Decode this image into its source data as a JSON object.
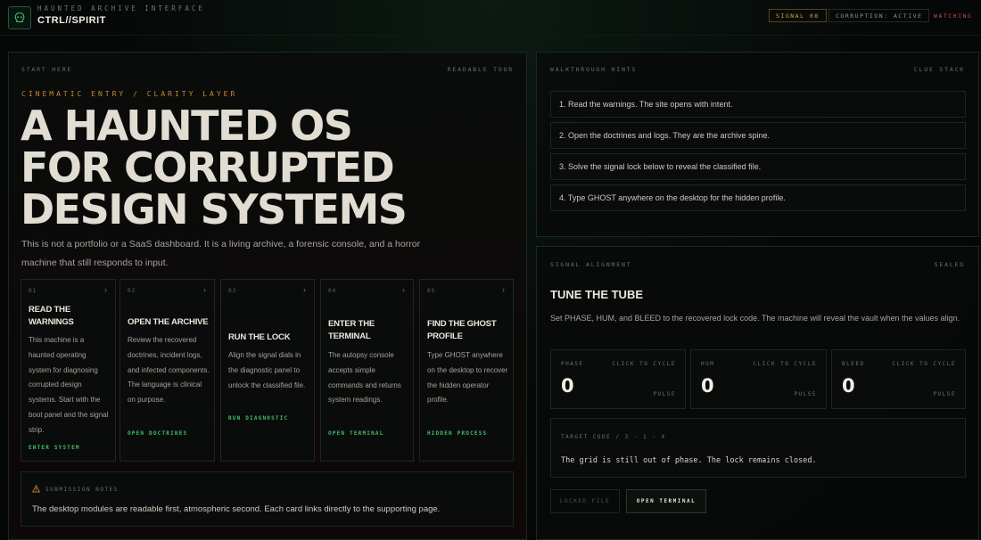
{
  "header": {
    "kicker": "HAUNTED ARCHIVE INTERFACE",
    "title": "CTRL//SPIRIT",
    "chips": {
      "signal": "SIGNAL 08",
      "corruption": "CORRUPTION: ACTIVE",
      "watching": "WATCHING"
    }
  },
  "colors": {
    "accent_amber": "#c8872a",
    "accent_green": "#3fbf6a",
    "alert_red": "#c94b3f"
  },
  "start": {
    "label_left": "START HERE",
    "label_right": "READABLE TOUR",
    "kicker": "CINEMATIC ENTRY / CLARITY LAYER",
    "headline": [
      "A HAUNTED OS",
      "FOR CORRUPTED",
      "DESIGN SYSTEMS"
    ],
    "intro": "This is not a portfolio or a SaaS dashboard. It is a living archive, a forensic console, and a horror machine that still responds to input.",
    "cards": [
      {
        "num": "01",
        "title": "READ THE WARNINGS",
        "body": "This machine is a haunted operating system for diagnosing corrupted design systems. Start with the boot panel and the signal strip.",
        "link": "ENTER SYSTEM"
      },
      {
        "num": "02",
        "title": "OPEN THE ARCHIVE",
        "body": "Review the recovered doctrines, incident logs, and infected components. The language is clinical on purpose.",
        "link": "OPEN DOCTRINES"
      },
      {
        "num": "03",
        "title": "RUN THE LOCK",
        "body": "Align the signal dials in the diagnostic panel to unlock the classified file.",
        "link": "RUN DIAGNOSTIC"
      },
      {
        "num": "04",
        "title": "ENTER THE TERMINAL",
        "body": "The autopsy console accepts simple commands and returns system readings.",
        "link": "OPEN TERMINAL"
      },
      {
        "num": "05",
        "title": "FIND THE GHOST PROFILE",
        "body": "Type GHOST anywhere on the desktop to recover the hidden operator profile.",
        "link": "HIDDEN PROCESS"
      }
    ],
    "notes": {
      "label": "SUBMISSION NOTES",
      "text": "The desktop modules are readable first, atmospheric second. Each card links directly to the supporting page."
    }
  },
  "hints": {
    "label_left": "WALKTHROUGH HINTS",
    "label_right": "CLUE STACK",
    "items": [
      "1. Read the warnings. The site opens with intent.",
      "2. Open the doctrines and logs. They are the archive spine.",
      "3. Solve the signal lock below to reveal the classified file.",
      "4. Type GHOST anywhere on the desktop for the hidden profile."
    ]
  },
  "signal": {
    "label_left": "SIGNAL ALIGNMENT",
    "label_right": "SEALED",
    "title": "TUNE THE TUBE",
    "description": "Set PHASE, HUM, and BLEED to the recovered lock code. The machine will reveal the vault when the values align.",
    "dials": [
      {
        "label": "PHASE",
        "cycle": "CLICK TO CYCLE",
        "value": "0",
        "pulse": "PULSE"
      },
      {
        "label": "HUM",
        "cycle": "CLICK TO CYCLE",
        "value": "0",
        "pulse": "PULSE"
      },
      {
        "label": "BLEED",
        "cycle": "CLICK TO CYCLE",
        "value": "0",
        "pulse": "PULSE"
      }
    ],
    "target": {
      "label": "TARGET CODE / 3 - 1 - 4",
      "text": "The grid is still out of phase. The lock remains closed."
    },
    "buttons": {
      "locked": "LOCKED FILE",
      "open": "OPEN TERMINAL"
    }
  }
}
